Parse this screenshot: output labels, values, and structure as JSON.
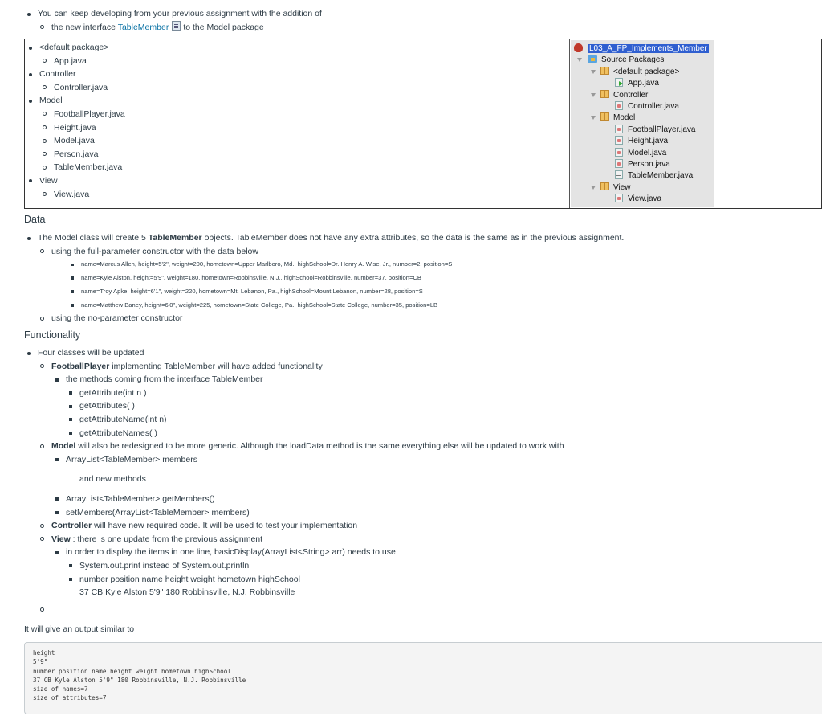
{
  "intro": {
    "line1": "You can keep developing from your previous assignment with the addition of",
    "line2_prefix": "the new interface ",
    "line2_link": "TableMember",
    "line2_suffix": "to the Model package"
  },
  "packages": [
    {
      "name": "<default package>",
      "files": [
        "App.java"
      ]
    },
    {
      "name": "Controller",
      "files": [
        "Controller.java"
      ]
    },
    {
      "name": "Model",
      "files": [
        "FootballPlayer.java",
        "Height.java",
        "Model.java",
        "Person.java",
        "TableMember.java"
      ]
    },
    {
      "name": "View",
      "files": [
        "View.java"
      ]
    }
  ],
  "netbeans": {
    "project": "L03_A_FP_Implements_Member",
    "source_packages": "Source Packages",
    "tree": [
      {
        "package": "<default package>",
        "files": [
          {
            "name": "App.java",
            "icon": "main-class-icon"
          }
        ]
      },
      {
        "package": "Controller",
        "files": [
          {
            "name": "Controller.java",
            "icon": "java-class-icon"
          }
        ]
      },
      {
        "package": "Model",
        "files": [
          {
            "name": "FootballPlayer.java",
            "icon": "java-class-icon"
          },
          {
            "name": "Height.java",
            "icon": "java-class-icon"
          },
          {
            "name": "Model.java",
            "icon": "java-class-icon"
          },
          {
            "name": "Person.java",
            "icon": "java-class-icon"
          },
          {
            "name": "TableMember.java",
            "icon": "interface-icon"
          }
        ]
      },
      {
        "package": "View",
        "files": [
          {
            "name": "View.java",
            "icon": "java-class-icon"
          }
        ]
      }
    ]
  },
  "data_section": {
    "heading": "Data",
    "line1_prefix": "The Model class will create 5 ",
    "line1_bold": "TableMember",
    "line1_suffix": " objects. TableMember does not have any extra attributes, so the data is the same as in the previous assignment.",
    "full_constructor": "using the full-parameter constructor with the data below",
    "records": [
      "name=Marcus Allen, height=5'2\", weight=200, hometown=Upper Marlboro, Md., highSchool=Dr. Henry A. Wise, Jr., number=2, position=S",
      "name=Kyle Alston, height=5'9\", weight=180, hometown=Robbinsville, N.J., highSchool=Robbinsville, number=37, position=CB",
      "name=Troy Apke, height=6'1\", weight=220, hometown=Mt. Lebanon, Pa., highSchool=Mount Lebanon, number=28, position=S",
      "name=Matthew Baney, height=6'0\", weight=225, hometown=State College, Pa., highSchool=State College, number=35, position=LB"
    ],
    "no_param": "using the no-parameter constructor"
  },
  "functionality": {
    "heading": "Functionality",
    "four_classes": "Four classes will be updated",
    "football": {
      "bold": "FootballPlayer",
      "text": " implementing TableMember will have added functionality"
    },
    "methods_intro": "the methods coming from the interface TableMember",
    "methods": [
      "getAttribute(int n )",
      "getAttributes( )",
      "getAttributeName(int n)",
      "getAttributeNames( )"
    ],
    "model": {
      "bold": "Model",
      "text": " will also be redesigned to be more generic. Although the loadData method is the same everything else will be updated to work with"
    },
    "model_member": "ArrayList<TableMember> members",
    "and_new_methods": "and new methods",
    "model_methods": [
      "ArrayList<TableMember> getMembers()",
      "setMembers(ArrayList<TableMember> members)"
    ],
    "controller": {
      "bold": "Controller",
      "text": " will have new required code. It will be used to test your implementation"
    },
    "view": {
      "bold": "View",
      "text": " : there is one update from the previous assignment"
    },
    "view_detail": "in order to display the items in one line, basicDisplay(ArrayList<String> arr) needs to use",
    "view_items": [
      "System.out.print instead of System.out.println",
      "number position name height weight hometown highSchool"
    ],
    "view_example": "37 CB Kyle Alston 5'9\" 180 Robbinsville, N.J. Robbinsville"
  },
  "output": {
    "intro": "It will give an output similar to",
    "lines": [
      "height",
      "5'9\"",
      "number position name height weight hometown highSchool",
      "37 CB Kyle Alston 5'9\" 180 Robbinsville, N.J. Robbinsville",
      "size of names=7",
      "size of attributes=7"
    ]
  }
}
